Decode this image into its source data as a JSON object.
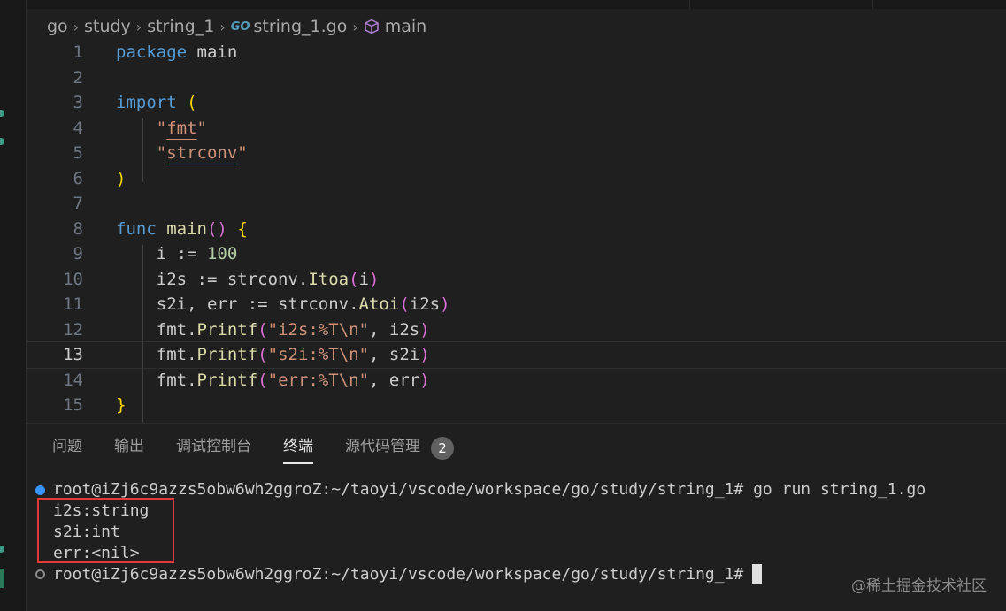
{
  "breadcrumb": {
    "items": [
      "go",
      "study",
      "string_1",
      "string_1.go",
      "main"
    ],
    "go_icon_label": "GO"
  },
  "editor": {
    "current_line": 13,
    "lines": [
      {
        "no": "1"
      },
      {
        "no": "2"
      },
      {
        "no": "3"
      },
      {
        "no": "4"
      },
      {
        "no": "5"
      },
      {
        "no": "6"
      },
      {
        "no": "7"
      },
      {
        "no": "8"
      },
      {
        "no": "9"
      },
      {
        "no": "10"
      },
      {
        "no": "11"
      },
      {
        "no": "12"
      },
      {
        "no": "13"
      },
      {
        "no": "14"
      },
      {
        "no": "15"
      }
    ],
    "code": {
      "l1_kw": "package",
      "l1_id": "main",
      "l3_kw": "import",
      "l3_paren": "(",
      "l4_q1": "\"",
      "l4_pkg": "fmt",
      "l4_q2": "\"",
      "l5_q1": "\"",
      "l5_pkg": "strconv",
      "l5_q2": "\"",
      "l6_paren": ")",
      "l8_kw": "func",
      "l8_fn": "main",
      "l8_parens": "()",
      "l8_brace": "{",
      "l9_a": "i := ",
      "l9_num": "100",
      "l10_a": "i2s := strconv.",
      "l10_fn": "Itoa",
      "l10_p1": "(",
      "l10_arg": "i",
      "l10_p2": ")",
      "l11_a": "s2i, err := strconv.",
      "l11_fn": "Atoi",
      "l11_p1": "(",
      "l11_arg": "i2s",
      "l11_p2": ")",
      "l12_a": "fmt.",
      "l12_fn": "Printf",
      "l12_p1": "(",
      "l12_str": "\"i2s:%T\\n\"",
      "l12_arg": ", i2s",
      "l12_p2": ")",
      "l13_a": "fmt.",
      "l13_fn": "Printf",
      "l13_p1": "(",
      "l13_str": "\"s2i:%T\\n\"",
      "l13_arg": ", s2i",
      "l13_p2": ")",
      "l14_a": "fmt.",
      "l14_fn": "Printf",
      "l14_p1": "(",
      "l14_str": "\"err:%T\\n\"",
      "l14_arg": ", err",
      "l14_p2": ")",
      "l15_brace": "}"
    }
  },
  "panel": {
    "tabs": [
      "问题",
      "输出",
      "调试控制台",
      "终端",
      "源代码管理"
    ],
    "active_tab": "终端",
    "scm_badge": "2"
  },
  "terminal": {
    "prompt1": "root@iZj6c9azzs5obw6wh2ggroZ:~/taoyi/vscode/workspace/go/study/string_1# go run string_1.go",
    "out1": "i2s:string",
    "out2": "s2i:int",
    "out3": "err:<nil>",
    "prompt2": "root@iZj6c9azzs5obw6wh2ggroZ:~/taoyi/vscode/workspace/go/study/string_1#"
  },
  "watermark": "@稀土掘金技术社区",
  "colors": {
    "background": "#1f1f1f",
    "keyword": "#569cd6",
    "function": "#dcdcaa",
    "string": "#ce9178",
    "number": "#b5cea8",
    "bracket_1": "#ffd700",
    "bracket_2": "#da70d6",
    "highlight_box": "#e03a3a",
    "terminal_marker": "#3794ff"
  }
}
